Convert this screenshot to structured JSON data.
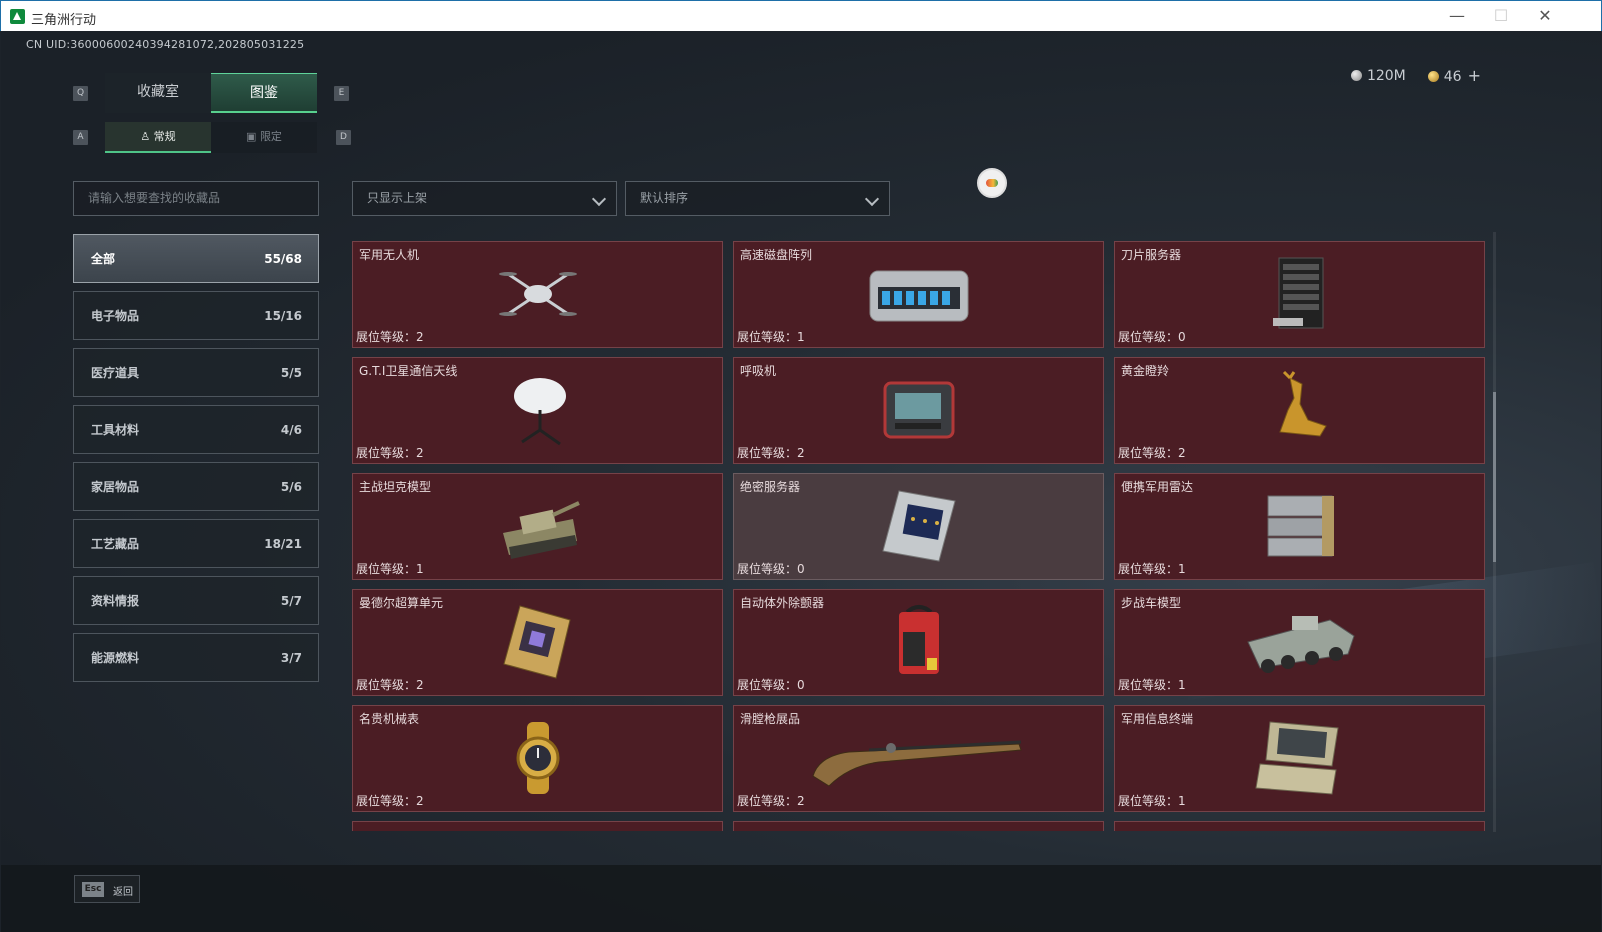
{
  "window": {
    "title": "三角洲行动",
    "minimize": "—",
    "maximize": "☐",
    "close": "✕"
  },
  "uid": "CN UID:36000600240394281072,202805031225",
  "currency": {
    "silver": "120M",
    "gold": "46",
    "plus": "+"
  },
  "hotkeys": {
    "prev_tab": "Q",
    "next_tab": "E",
    "prev_sub": "A",
    "next_sub": "D"
  },
  "tabs": [
    {
      "label": "收藏室"
    },
    {
      "label": "图鉴"
    }
  ],
  "subtabs": [
    {
      "label": "常规"
    },
    {
      "label": "限定"
    }
  ],
  "search": {
    "placeholder": "请输入想要查找的收藏品"
  },
  "filters": {
    "shelf": "只显示上架",
    "sort": "默认排序"
  },
  "categories": [
    {
      "label": "全部",
      "count": "55/68"
    },
    {
      "label": "电子物品",
      "count": "15/16"
    },
    {
      "label": "医疗道具",
      "count": "5/5"
    },
    {
      "label": "工具材料",
      "count": "4/6"
    },
    {
      "label": "家居物品",
      "count": "5/6"
    },
    {
      "label": "工艺藏品",
      "count": "18/21"
    },
    {
      "label": "资料情报",
      "count": "5/7"
    },
    {
      "label": "能源燃料",
      "count": "3/7"
    }
  ],
  "items": [
    {
      "name": "军用无人机",
      "level": "展位等级：2",
      "icon": "drone-icon"
    },
    {
      "name": "高速磁盘阵列",
      "level": "展位等级：1",
      "icon": "disk-array-icon"
    },
    {
      "name": "刀片服务器",
      "level": "展位等级：0",
      "icon": "blade-server-icon"
    },
    {
      "name": "G.T.I卫星通信天线",
      "level": "展位等级：2",
      "icon": "satellite-dish-icon"
    },
    {
      "name": "呼吸机",
      "level": "展位等级：2",
      "icon": "ventilator-icon"
    },
    {
      "name": "黄金瞪羚",
      "level": "展位等级：2",
      "icon": "gazelle-icon"
    },
    {
      "name": "主战坦克模型",
      "level": "展位等级：1",
      "icon": "tank-icon"
    },
    {
      "name": "绝密服务器",
      "level": "展位等级：0",
      "icon": "server-board-icon"
    },
    {
      "name": "便携军用雷达",
      "level": "展位等级：1",
      "icon": "radar-icon"
    },
    {
      "name": "曼德尔超算单元",
      "level": "展位等级：2",
      "icon": "supercomputer-icon"
    },
    {
      "name": "自动体外除颤器",
      "level": "展位等级：0",
      "icon": "defibrillator-icon"
    },
    {
      "name": "步战车模型",
      "level": "展位等级：1",
      "icon": "ifv-icon"
    },
    {
      "name": "名贵机械表",
      "level": "展位等级：2",
      "icon": "watch-icon"
    },
    {
      "name": "滑膛枪展品",
      "level": "展位等级：2",
      "icon": "musket-icon"
    },
    {
      "name": "军用信息终端",
      "level": "展位等级：1",
      "icon": "terminal-icon"
    }
  ],
  "footer": {
    "esc": "Esc",
    "back": "返回"
  }
}
